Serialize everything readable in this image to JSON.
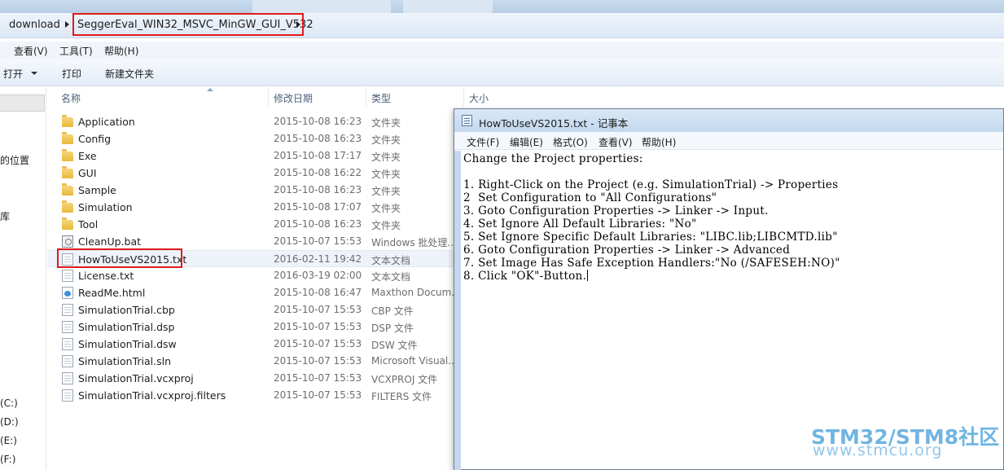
{
  "address_bar": {
    "crumbs": [
      "download",
      "SeggerEval_WIN32_MSVC_MinGW_GUI_V532"
    ]
  },
  "menubar": [
    "查看(V)",
    "工具(T)",
    "帮助(H)"
  ],
  "toolbar": {
    "open": "打开",
    "print": "打印",
    "new_folder": "新建文件夹"
  },
  "nav_pane": {
    "items": [
      "的位置",
      "库",
      "(C:)",
      "(D:)",
      "(E:)",
      "(F:)"
    ]
  },
  "columns": {
    "name": "名称",
    "date": "修改日期",
    "type": "类型",
    "size": "大小"
  },
  "files": [
    {
      "name": "Application",
      "date": "2015-10-08 16:23",
      "type": "文件夹",
      "icon": "folder-icon"
    },
    {
      "name": "Config",
      "date": "2015-10-08 16:23",
      "type": "文件夹",
      "icon": "folder-icon"
    },
    {
      "name": "Exe",
      "date": "2015-10-08 17:17",
      "type": "文件夹",
      "icon": "folder-icon"
    },
    {
      "name": "GUI",
      "date": "2015-10-08 16:22",
      "type": "文件夹",
      "icon": "folder-icon"
    },
    {
      "name": "Sample",
      "date": "2015-10-08 16:23",
      "type": "文件夹",
      "icon": "folder-icon"
    },
    {
      "name": "Simulation",
      "date": "2015-10-08 17:07",
      "type": "文件夹",
      "icon": "folder-icon"
    },
    {
      "name": "Tool",
      "date": "2015-10-08 16:23",
      "type": "文件夹",
      "icon": "folder-icon"
    },
    {
      "name": "CleanUp.bat",
      "date": "2015-10-07 15:53",
      "type": "Windows 批处理...",
      "icon": "batch-file-icon"
    },
    {
      "name": "HowToUseVS2015.txt",
      "date": "2016-02-11 19:42",
      "type": "文本文档",
      "icon": "text-file-icon"
    },
    {
      "name": "License.txt",
      "date": "2016-03-19 02:00",
      "type": "文本文档",
      "icon": "text-file-icon"
    },
    {
      "name": "ReadMe.html",
      "date": "2015-10-08 16:47",
      "type": "Maxthon Docum...",
      "icon": "html-file-icon"
    },
    {
      "name": "SimulationTrial.cbp",
      "date": "2015-10-07 15:53",
      "type": "CBP 文件",
      "icon": "file-icon"
    },
    {
      "name": "SimulationTrial.dsp",
      "date": "2015-10-07 15:53",
      "type": "DSP 文件",
      "icon": "file-icon"
    },
    {
      "name": "SimulationTrial.dsw",
      "date": "2015-10-07 15:53",
      "type": "DSW 文件",
      "icon": "file-icon"
    },
    {
      "name": "SimulationTrial.sln",
      "date": "2015-10-07 15:53",
      "type": "Microsoft Visual...",
      "icon": "file-icon"
    },
    {
      "name": "SimulationTrial.vcxproj",
      "date": "2015-10-07 15:53",
      "type": "VCXPROJ 文件",
      "icon": "file-icon"
    },
    {
      "name": "SimulationTrial.vcxproj.filters",
      "date": "2015-10-07 15:53",
      "type": "FILTERS 文件",
      "icon": "file-icon"
    }
  ],
  "notepad": {
    "title": "HowToUseVS2015.txt - 记事本",
    "menu": [
      "文件(F)",
      "编辑(E)",
      "格式(O)",
      "查看(V)",
      "帮助(H)"
    ],
    "lines": [
      "Change the Project properties:",
      "",
      "1. Right-Click on the Project (e.g. SimulationTrial) -> Properties",
      "2  Set Configuration to \"All Configurations\"",
      "3. Goto Configuration Properties -> Linker -> Input.",
      "4. Set Ignore All Default Libraries: \"No\"",
      "5. Set Ignore Specific Default Libraries: \"LIBC.lib;LIBCMTD.lib\"",
      "6. Goto Configuration Properties -> Linker -> Advanced",
      "7. Set Image Has Safe Exception Handlers:\"No (/SAFESEH:NO)\"",
      "8. Click \"OK\"-Button."
    ]
  },
  "watermark": {
    "line1": "STM32/STM8社区",
    "line2": "www.stmcu.org"
  }
}
